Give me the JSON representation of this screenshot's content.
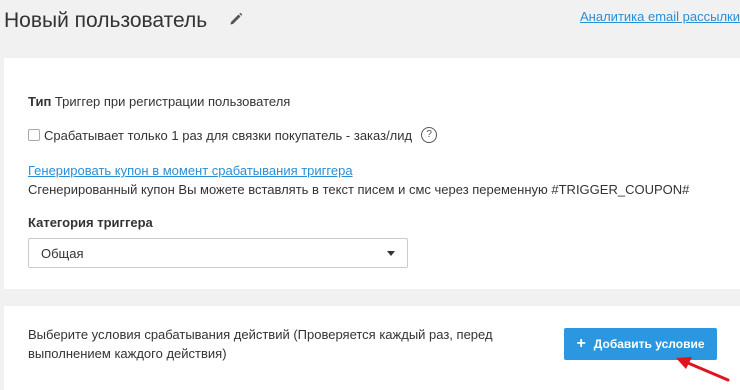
{
  "header": {
    "title": "Новый пользователь",
    "analytics_link": "Аналитика email рассылки"
  },
  "trigger": {
    "type_label": "Тип",
    "type_value": "Триггер при регистрации пользователя",
    "once_checkbox_label": "Срабатывает только 1 раз для связки покупатель - заказ/лид",
    "once_checked": false,
    "help_glyph": "?",
    "coupon_link": "Генерировать купон в момент срабатывания триггера",
    "coupon_note": "Сгенерированный купон Вы можете вставлять в текст писем и смс через переменную #TRIGGER_COUPON#",
    "category_label": "Категория триггера",
    "category_value": "Общая"
  },
  "conditions": {
    "text": "Выберите условия срабатывания действий (Проверяется каждый раз, перед выполнением каждого действия)",
    "add_button_label": "Добавить условие",
    "add_button_icon": "plus-icon"
  },
  "colors": {
    "accent": "#2a97e0",
    "link": "#2a8fd6",
    "annotation_arrow": "#e0141e"
  }
}
